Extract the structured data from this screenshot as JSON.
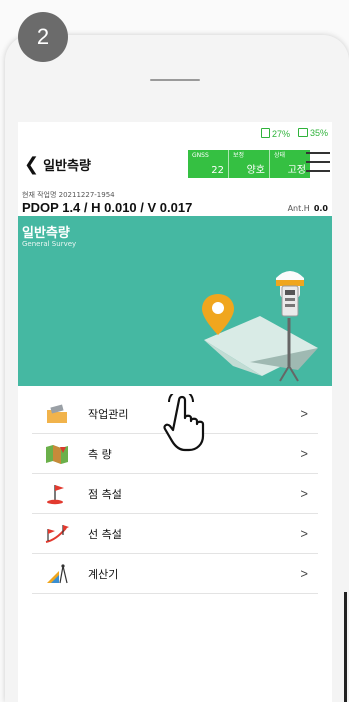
{
  "step": "2",
  "status": {
    "battery1": "27%",
    "battery2": "35%"
  },
  "header": {
    "title": "일반측량",
    "gnss": {
      "label": "GNSS",
      "value": "22"
    },
    "correction": {
      "label": "보정",
      "value": "양호"
    },
    "state": {
      "label": "상태",
      "value": "고정"
    }
  },
  "job": {
    "label": "현재 작업명 20211227-1954",
    "pdop": "PDOP 1.4 / H 0.010 / V 0.017",
    "ant_label": "Ant.H",
    "ant_value": "0.0"
  },
  "banner": {
    "title": "일반측량",
    "subtitle": "General Survey"
  },
  "menu": [
    {
      "label": "작업관리",
      "icon": "folder-icon"
    },
    {
      "label": "측 량",
      "icon": "map-icon"
    },
    {
      "label": "점 측설",
      "icon": "point-flag-icon"
    },
    {
      "label": "선 측설",
      "icon": "line-flag-icon"
    },
    {
      "label": "계산기",
      "icon": "calculator-icon"
    }
  ],
  "colors": {
    "gnss_green": "#35c042",
    "banner_teal": "#45b8a2"
  }
}
